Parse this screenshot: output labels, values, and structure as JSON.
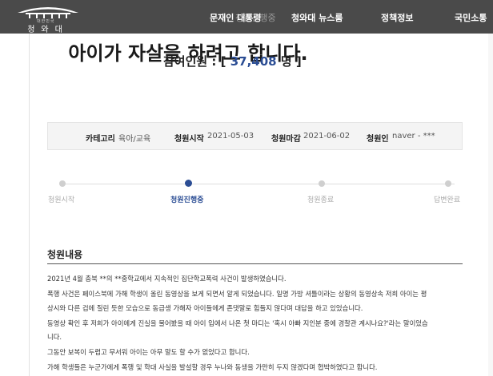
{
  "header": {
    "logo_small": "대한민국",
    "logo_name": "청와대",
    "ghost_text": "청원진행중",
    "nav": [
      {
        "label": "문재인 대통령"
      },
      {
        "label": "청와대 뉴스룸"
      },
      {
        "label": "정책정보"
      },
      {
        "label": "국민소통"
      }
    ]
  },
  "petition": {
    "title": "아이가 자살을 하려고 합니다.",
    "participants_label": "참여인원 : [",
    "participants_count": "37,408",
    "participants_suffix": "명 ]",
    "info": {
      "category_label": "카테고리",
      "category_value": "육아/교육",
      "start_label": "청원시작",
      "start_value": "2021-05-03",
      "end_label": "청원마감",
      "end_value": "2021-06-02",
      "author_label": "청원인",
      "author_value": "naver - ***"
    },
    "steps": [
      {
        "label": "청원시작"
      },
      {
        "label": "청원진행중"
      },
      {
        "label": "청원종료"
      },
      {
        "label": "답변완료"
      }
    ],
    "current_step": 1,
    "section_title": "청원내용",
    "body": [
      "2021년 4월 충북 **의 **중학교에서 지속적인 집단학교폭력 사건이 발생하였습니다.",
      "폭행 사건은 페이스북에 가해 학생이 올린 동영상을 보게 되면서 알게 되었습니다. 일명 가방 셔틀이라는 상황의 동영상속 저희 아이는 평",
      "상시와 다른 겁에 질린 듯한 모습으로 동급생 가해자 아이들에게 존댓말로 힘들지 않다며 대답을 하고 있었습니다.",
      "동영상 확인 후 저희가 아이에게 진실을 물어봤을 때 아이 입에서 나온 첫 마디는 '혹시 아빠 지인분 중에 경찰관 계시나요?'라는 말이었습",
      "니다.",
      "그동안 보복이 두렵고 무서워 아이는 아무 말도 할 수가 없었다고 합니다.",
      "가해 학생들은 누군가에게 폭행 및 학대 사실을 발설할 경우 누나와 동생을 가만히 두지 않겠다며 협박하였다고 합니다."
    ]
  }
}
